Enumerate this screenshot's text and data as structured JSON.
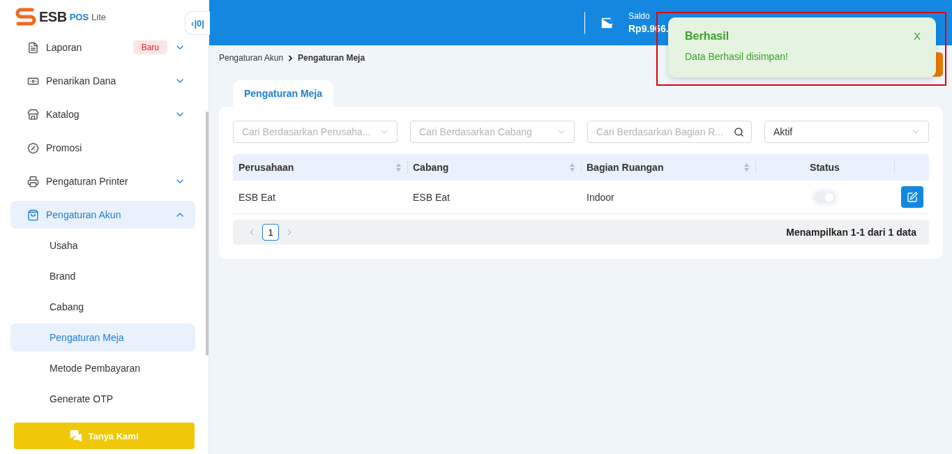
{
  "sidebar": {
    "logo": {
      "main": "ESB",
      "sub": "POS",
      "sub2": "Lite"
    },
    "collapse_label": "‹|0|",
    "items": [
      {
        "label": "Laporan",
        "badge": "Baru",
        "expanded": false,
        "selected": false
      },
      {
        "label": "Penarikan Dana",
        "expanded": false,
        "selected": false
      },
      {
        "label": "Katalog",
        "expanded": false,
        "selected": false
      },
      {
        "label": "Promosi",
        "selected": false
      },
      {
        "label": "Pengaturan Printer",
        "expanded": false,
        "selected": false
      },
      {
        "label": "Pengaturan Akun",
        "expanded": true,
        "selected": true,
        "children": [
          {
            "label": "Usaha",
            "selected": false
          },
          {
            "label": "Brand",
            "selected": false
          },
          {
            "label": "Cabang",
            "selected": false
          },
          {
            "label": "Pengaturan Meja",
            "selected": true
          },
          {
            "label": "Metode Pembayaran",
            "selected": false
          },
          {
            "label": "Generate OTP",
            "selected": false
          }
        ]
      }
    ],
    "help_button": "Tanya Kami"
  },
  "header": {
    "balance_label": "Saldo",
    "balance_value": "Rp9.966."
  },
  "breadcrumb": [
    {
      "label": "Pengaturan Akun",
      "current": false
    },
    {
      "label": "Pengaturan Meja",
      "current": true
    }
  ],
  "tabs": [
    {
      "label": "Pengaturan Meja",
      "selected": true
    }
  ],
  "filters": [
    {
      "kind": "select",
      "placeholder": "Cari Berdasarkan Perusaha..."
    },
    {
      "kind": "select",
      "placeholder": "Cari Berdasarkan Cabang"
    },
    {
      "kind": "search",
      "placeholder": "Cari Berdasarkan Bagian R..."
    },
    {
      "kind": "select",
      "value": "Aktif"
    }
  ],
  "table": {
    "columns": [
      {
        "label": "Perusahaan",
        "sortable": true
      },
      {
        "label": "Cabang",
        "sortable": true
      },
      {
        "label": "Bagian Ruangan",
        "sortable": true
      },
      {
        "label": "Status",
        "sortable": false
      },
      {
        "sortable": false
      }
    ],
    "rows": [
      {
        "company": "ESB Eat",
        "branch": "ESB Eat",
        "room": "Indoor",
        "active": true,
        "disabled": true
      }
    ]
  },
  "pagination": {
    "pages": [
      {
        "label": "1",
        "selected": true
      }
    ],
    "summary": "Menampilkan 1-1 dari 1 data"
  },
  "toast": {
    "title": "Berhasil",
    "message": "Data Berhasil disimpan!",
    "close": "X",
    "highlighted": true
  }
}
